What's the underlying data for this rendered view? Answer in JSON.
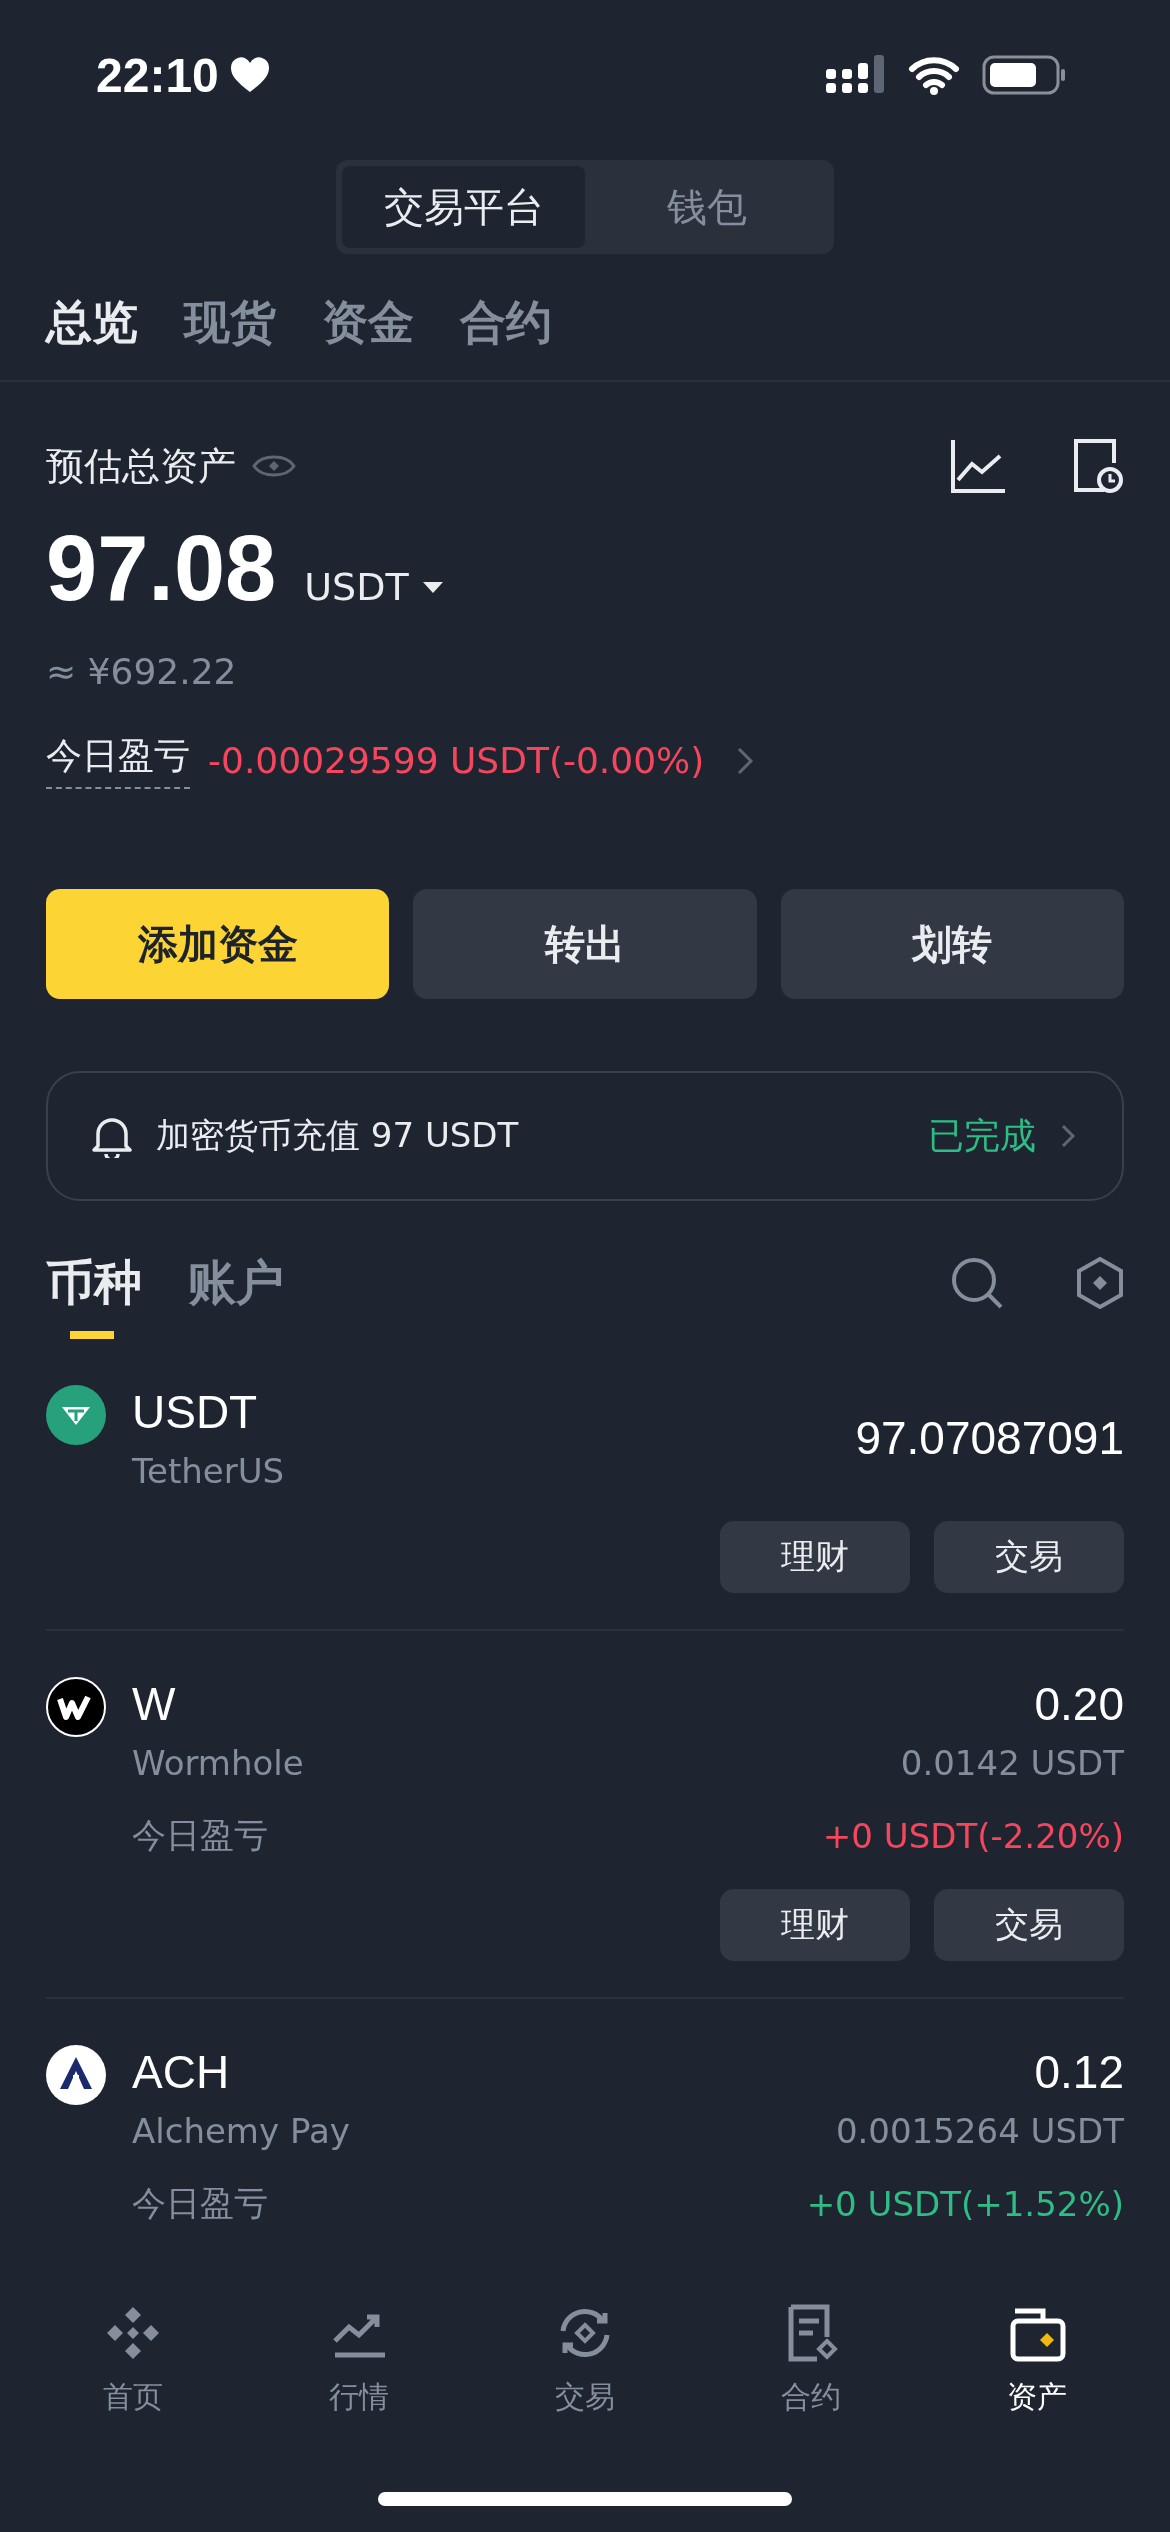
{
  "status_bar": {
    "time": "22:10"
  },
  "segment": [
    {
      "label": "交易平台",
      "selected": true
    },
    {
      "label": "钱包",
      "selected": false
    }
  ],
  "tabs": [
    {
      "label": "总览",
      "selected": true
    },
    {
      "label": "现货",
      "selected": false
    },
    {
      "label": "资金",
      "selected": false
    },
    {
      "label": "合约",
      "selected": false
    }
  ],
  "summary": {
    "title": "预估总资产",
    "amount": "97.08",
    "currency": "USDT",
    "fiat": "≈ ¥692.22",
    "pnl_label": "今日盈亏",
    "pnl": "-0.00029599 USDT(-0.00%)",
    "negative": true
  },
  "actions": [
    {
      "label": "添加资金",
      "primary": true
    },
    {
      "label": "转出",
      "primary": false
    },
    {
      "label": "划转",
      "primary": false
    }
  ],
  "notice": {
    "text": "加密货币充值 97 USDT",
    "status": "已完成"
  },
  "list_tabs": [
    {
      "label": "币种",
      "selected": true
    },
    {
      "label": "账户",
      "selected": false
    }
  ],
  "coins": [
    {
      "symbol": "USDT",
      "name": "TetherUS",
      "amount": "97.07087091",
      "kind": "tether",
      "buttons": [
        "理财",
        "交易"
      ]
    },
    {
      "symbol": "W",
      "name": "Wormhole",
      "amount": "0.20",
      "price": "0.0142 USDT",
      "pnl_label": "今日盈亏",
      "pnl": "+0 USDT(-2.20%)",
      "negative": true,
      "kind": "wormhole",
      "buttons": [
        "理财",
        "交易"
      ]
    },
    {
      "symbol": "ACH",
      "name": "Alchemy Pay",
      "amount": "0.12",
      "price": "0.0015264 USDT",
      "pnl_label": "今日盈亏",
      "pnl": "+0 USDT(+1.52%)",
      "negative": false,
      "kind": "alchemy"
    }
  ],
  "nav": [
    {
      "label": "首页",
      "kind": "home",
      "selected": false
    },
    {
      "label": "行情",
      "kind": "markets",
      "selected": false
    },
    {
      "label": "交易",
      "kind": "trade",
      "selected": false
    },
    {
      "label": "合约",
      "kind": "futures",
      "selected": false
    },
    {
      "label": "资产",
      "kind": "wallet",
      "selected": true
    }
  ]
}
